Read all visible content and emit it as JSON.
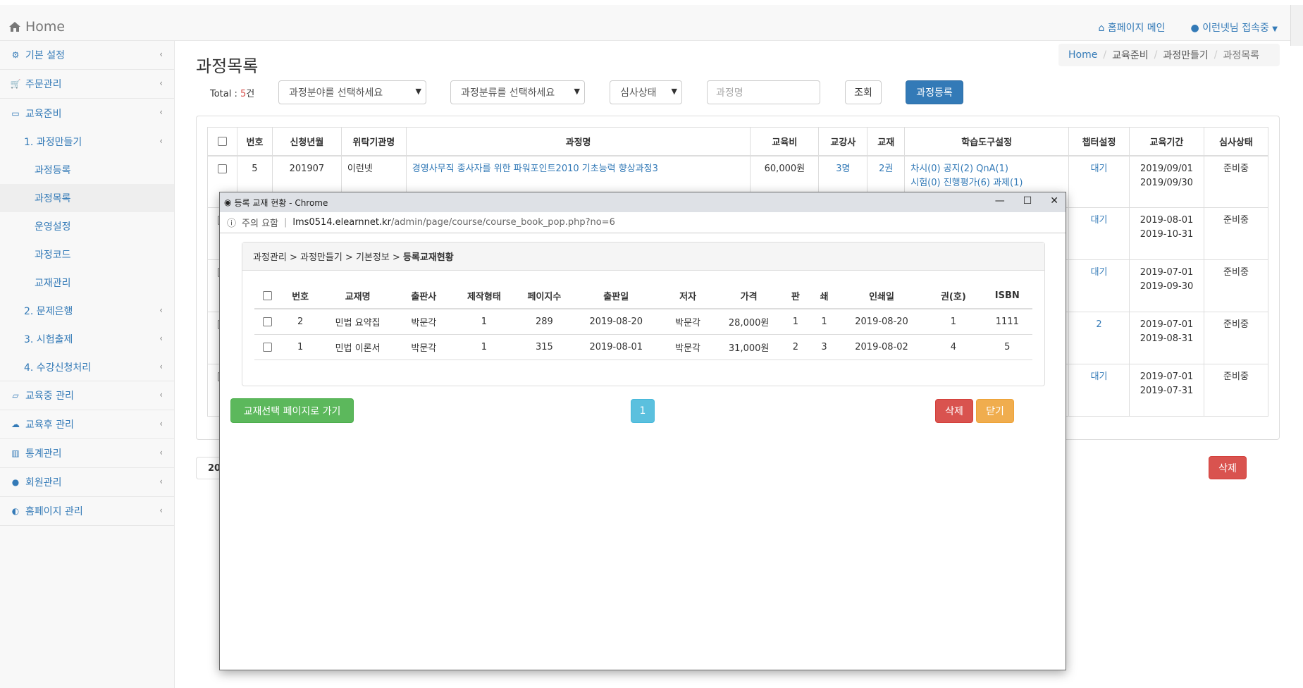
{
  "navbar": {
    "brand": "Home",
    "homepage_link": "홈페이지 메인",
    "user_menu": "이런넷님 접속중"
  },
  "sidebar": {
    "items": [
      {
        "label": "기본 설정",
        "icon": "gears-icon"
      },
      {
        "label": "주문관리",
        "icon": "cart-icon"
      },
      {
        "label": "교육준비",
        "icon": "laptop-icon"
      }
    ],
    "sub": {
      "step1": "1. 과정만들기",
      "course_register": "과정등록",
      "course_list": "과정목록",
      "operation": "운영설정",
      "course_code": "과정코드",
      "textbook_mgmt": "교재관리",
      "step2": "2. 문제은행",
      "step3": "3. 시험출제",
      "step4": "4. 수강신청처리"
    },
    "items2": [
      {
        "label": "교육중 관리",
        "icon": "folder-open-icon"
      },
      {
        "label": "교육후 관리",
        "icon": "cloud-upload-icon"
      },
      {
        "label": "통계관리",
        "icon": "bar-chart-icon"
      },
      {
        "label": "회원관리",
        "icon": "user-icon"
      },
      {
        "label": "홈페이지 관리",
        "icon": "dashboard-icon"
      }
    ]
  },
  "page": {
    "title": "과정목록",
    "breadcrumb": [
      "Home",
      "교육준비",
      "과정만들기",
      "과정목록"
    ]
  },
  "filters": {
    "total_label": "Total : ",
    "total_count": "5",
    "total_unit": "건",
    "field_select": "과정분야를 선택하세요",
    "category_select": "과정분류를 선택하세요",
    "status_select": "심사상태",
    "name_placeholder": "과정명",
    "search_button": "조회",
    "register_button": "과정등록"
  },
  "table": {
    "headers": [
      "",
      "번호",
      "신청년월",
      "위탁기관명",
      "과정명",
      "교육비",
      "교강사",
      "교재",
      "학습도구설정",
      "챕터설정",
      "교육기간",
      "심사상태"
    ],
    "rows": [
      {
        "no": "5",
        "ym": "201907",
        "org": "이런넷",
        "name": "경영사무직 종사자를 위한 파워포인트2010 기초능력 향상과정3",
        "fee": "60,000원",
        "teacher": "3명",
        "book": "2권",
        "tools1": "차시(0)  공지(2)  QnA(1)",
        "tools2": "시험(0)  진행평가(6)  과제(1)",
        "chapter": "대기",
        "p1": "2019/09/01",
        "p2": "2019/09/30",
        "status": "준비중"
      },
      {
        "chapter": "대기",
        "p1": "2019-08-01",
        "p2": "2019-10-31",
        "status": "준비중"
      },
      {
        "chapter": "대기",
        "p1": "2019-07-01",
        "p2": "2019-09-30",
        "status": "준비중"
      },
      {
        "chapter": "2",
        "p1": "2019-07-01",
        "p2": "2019-08-31",
        "status": "준비중"
      },
      {
        "chapter": "대기",
        "p1": "2019-07-01",
        "p2": "2019-07-31",
        "status": "준비중"
      }
    ],
    "pager_partial": "20",
    "delete_button": "삭제"
  },
  "popup": {
    "window_title": "등록 교재 현황 - Chrome",
    "security": "주의 요함",
    "url_host": "lms0514.elearnnet.kr",
    "url_path": "/admin/page/course/course_book_pop.php?no=6",
    "heading_path": "과정관리 > 과정만들기 > 기본정보 > ",
    "heading_current": "등록교재현황",
    "headers": [
      "",
      "번호",
      "교재명",
      "출판사",
      "제작형태",
      "페이지수",
      "출판일",
      "저자",
      "가격",
      "판",
      "쇄",
      "인쇄일",
      "권(호)",
      "ISBN"
    ],
    "rows": [
      [
        "2",
        "민법 요약집",
        "박문각",
        "1",
        "289",
        "2019-08-20",
        "박문각",
        "28,000원",
        "1",
        "1",
        "2019-08-20",
        "1",
        "1111"
      ],
      [
        "1",
        "민법 이론서",
        "박문각",
        "1",
        "315",
        "2019-08-01",
        "박문각",
        "31,000원",
        "2",
        "3",
        "2019-08-02",
        "4",
        "5"
      ]
    ],
    "goto_button": "교재선택 페이지로 가기",
    "page_number": "1",
    "delete_button": "삭제",
    "close_button": "닫기"
  }
}
